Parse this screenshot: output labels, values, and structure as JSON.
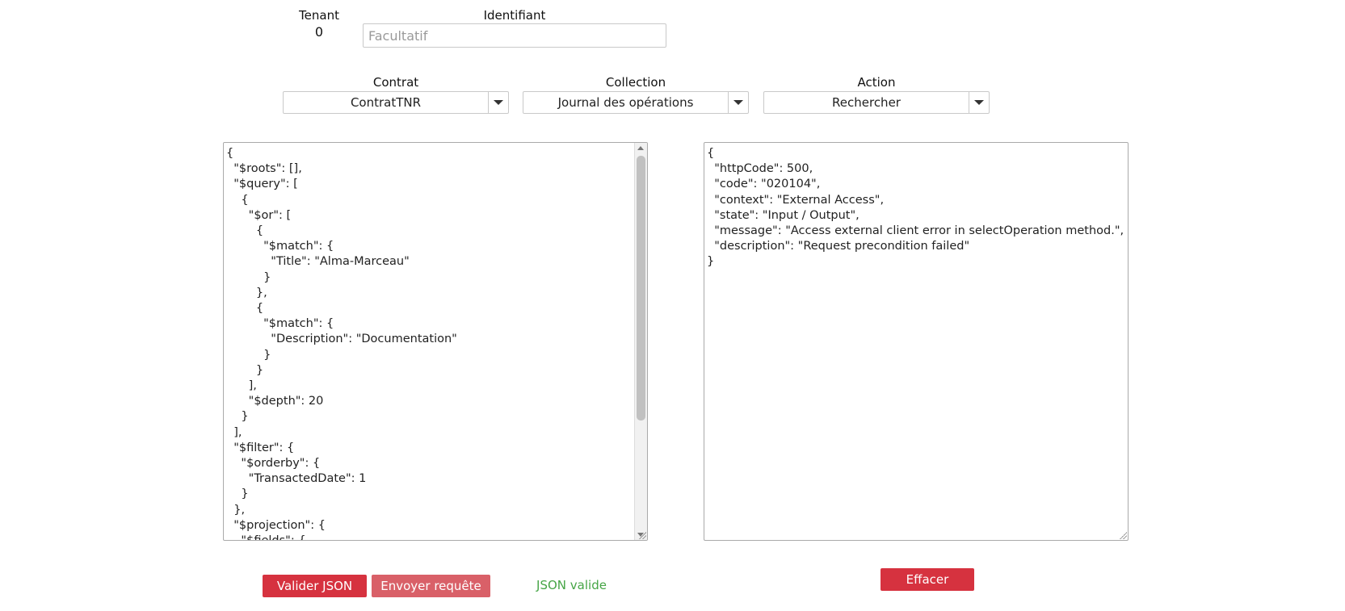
{
  "tenant": {
    "label": "Tenant",
    "value": "0"
  },
  "identifiant": {
    "label": "Identifiant",
    "placeholder": "Facultatif"
  },
  "contrat": {
    "label": "Contrat",
    "value": "ContratTNR"
  },
  "collection": {
    "label": "Collection",
    "value": "Journal des opérations"
  },
  "action": {
    "label": "Action",
    "value": "Rechercher"
  },
  "request_editor": {
    "text": "{\n  \"$roots\": [],\n  \"$query\": [\n    {\n      \"$or\": [\n        {\n          \"$match\": {\n            \"Title\": \"Alma-Marceau\"\n          }\n        },\n        {\n          \"$match\": {\n            \"Description\": \"Documentation\"\n          }\n        }\n      ],\n      \"$depth\": 20\n    }\n  ],\n  \"$filter\": {\n    \"$orderby\": {\n      \"TransactedDate\": 1\n    }\n  },\n  \"$projection\": {\n    \"$fields\": {"
  },
  "response_viewer": {
    "text": "{\n  \"httpCode\": 500,\n  \"code\": \"020104\",\n  \"context\": \"External Access\",\n  \"state\": \"Input / Output\",\n  \"message\": \"Access external client error in selectOperation method.\",\n  \"description\": \"Request precondition failed\"\n}"
  },
  "buttons": {
    "validate": "Valider JSON",
    "send": "Envoyer requête",
    "clear": "Effacer"
  },
  "status": {
    "text": "JSON valide",
    "color": "#46a546"
  },
  "colors": {
    "primary_button": "#d6323f",
    "secondary_button": "#d96068"
  },
  "icons": {
    "dropdown": "chevron-down-icon"
  }
}
